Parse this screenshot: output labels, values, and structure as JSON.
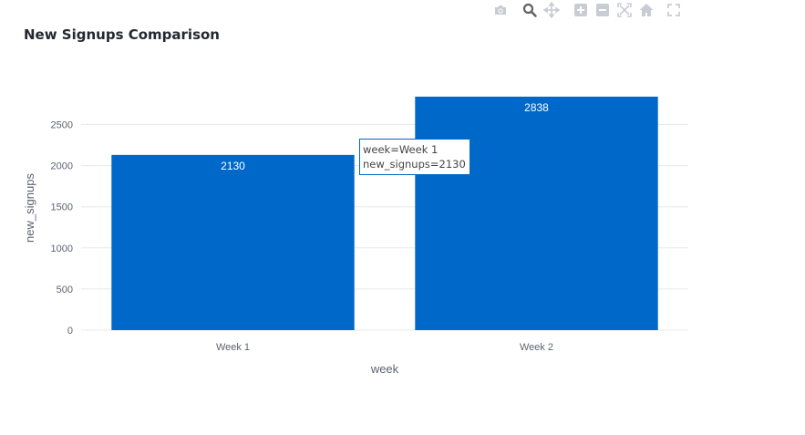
{
  "chart_data": {
    "type": "bar",
    "title": "New Signups Comparison",
    "xlabel": "week",
    "ylabel": "new_signups",
    "categories": [
      "Week 1",
      "Week 2"
    ],
    "values": [
      2130,
      2838
    ],
    "ylim": [
      0,
      2838
    ],
    "yticks": [
      0,
      500,
      1000,
      1500,
      2000,
      2500
    ],
    "grid": true,
    "bar_color": "#0068c9",
    "data_labels": true
  },
  "hover": {
    "line1": "week=Week 1",
    "line2": "new_signups=2130"
  },
  "modebar": {
    "icons": [
      "camera-icon",
      "zoom-icon",
      "pan-icon",
      "zoom-in-icon",
      "zoom-out-icon",
      "autoscale-icon",
      "home-icon",
      "fullscreen-icon"
    ]
  }
}
